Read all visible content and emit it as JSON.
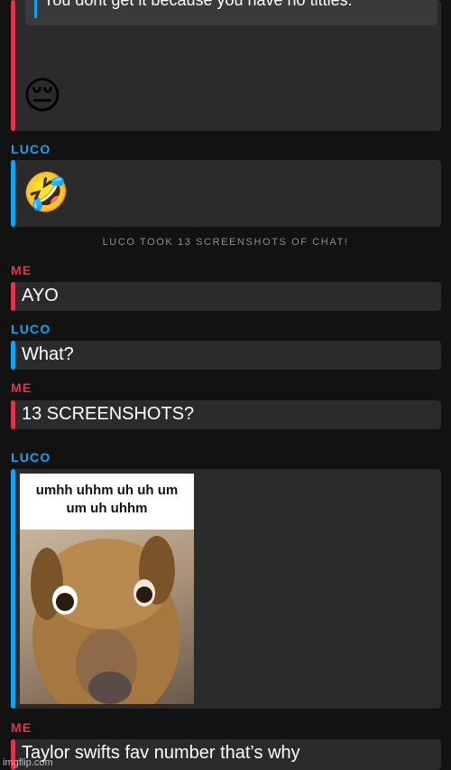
{
  "messages": {
    "quoted_text": "You dont get it because you have no titties.",
    "pensive_emoji": "😔",
    "luco_label_1": "LUCO",
    "rofl_emoji": "🤣",
    "system_notice": "LUCO TOOK 13 SCREENSHOTS OF CHAT!",
    "me_label_1": "ME",
    "me_text_1": "AYO",
    "luco_label_2": "LUCO",
    "luco_text_2": "What?",
    "me_label_2": "ME",
    "me_text_2": "13 SCREENSHOTS?",
    "luco_label_3": "LUCO",
    "gif_caption_line1": "umhh uhhm uh uh um",
    "gif_caption_line2": "um uh uhhm",
    "me_label_3": "ME",
    "me_text_3": "Taylor swifts fav number that’s why"
  },
  "watermark": "imgflip.com",
  "colors": {
    "me": "#e0344a",
    "luco": "#12a3ee",
    "background": "#121212",
    "card": "#2b2b2b"
  }
}
